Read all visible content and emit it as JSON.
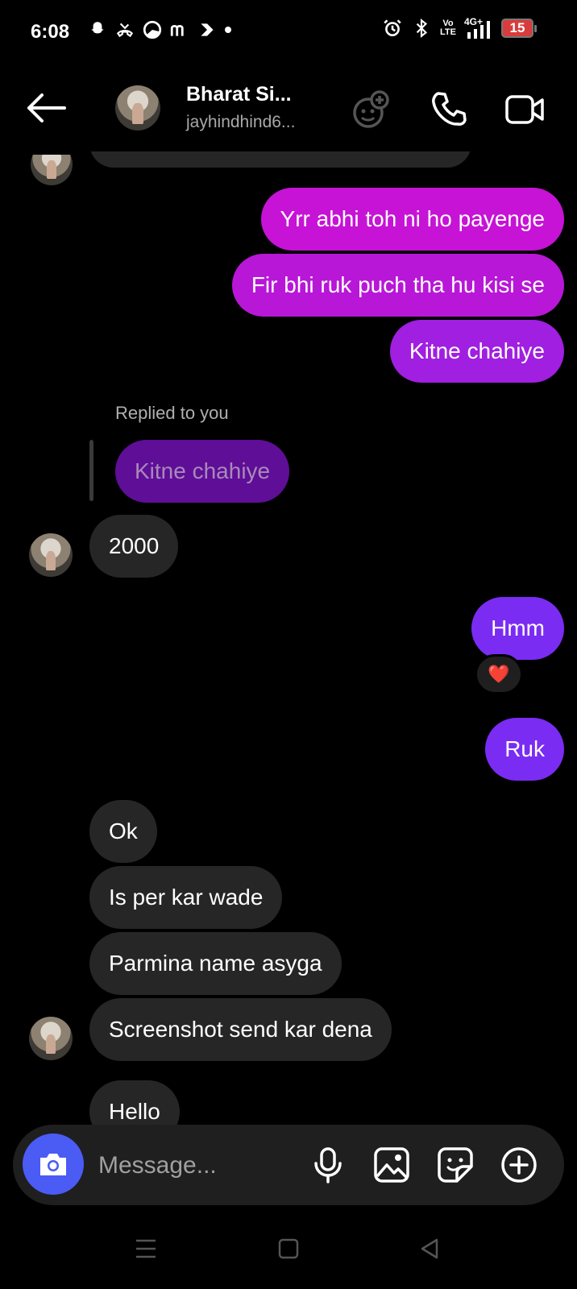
{
  "status_bar": {
    "time": "6:08",
    "volte": [
      "Vo",
      "LTE"
    ],
    "network": "4G+",
    "battery": "15",
    "icons_left": [
      "snapchat-icon",
      "missed-call-icon",
      "data-saver-icon",
      "m-app-icon",
      "play-app-icon",
      "dot-icon"
    ],
    "icons_right": [
      "alarm-icon",
      "bluetooth-icon",
      "volte-icon",
      "signal-icon",
      "battery-icon"
    ]
  },
  "header": {
    "name": "Bharat Si...",
    "username": "jayhindhind6...",
    "icons": [
      "back-arrow-icon",
      "add-effect-icon",
      "phone-icon",
      "video-call-icon"
    ]
  },
  "messages": {
    "out_1": "Yrr abhi toh ni ho payenge",
    "out_2": "Fir bhi ruk puch tha hu kisi se",
    "out_3": "Kitne chahiye",
    "reply_label": "Replied to you",
    "reply_quote": "Kitne chahiye",
    "in_1": "2000",
    "out_4": "Hmm",
    "reaction": "❤️",
    "out_5": "Ruk",
    "in_2": "Ok",
    "in_3": "Is per kar wade",
    "in_4": "Parmina name asyga",
    "in_5": "Screenshot send kar dena",
    "in_6": "Hello"
  },
  "colors": {
    "out_top": "#c613d6",
    "out_mid": "#b817d7",
    "out_low": "#a01fe0",
    "out_violet": "#7a2cf3",
    "incoming": "#262626",
    "camera_button": "#4a5cf4"
  },
  "composer": {
    "placeholder": "Message...",
    "icons": [
      "camera-icon",
      "microphone-icon",
      "gallery-icon",
      "sticker-icon",
      "plus-circle-icon"
    ]
  },
  "nav": {
    "icons": [
      "menu-icon",
      "home-square-icon",
      "back-triangle-icon"
    ]
  }
}
